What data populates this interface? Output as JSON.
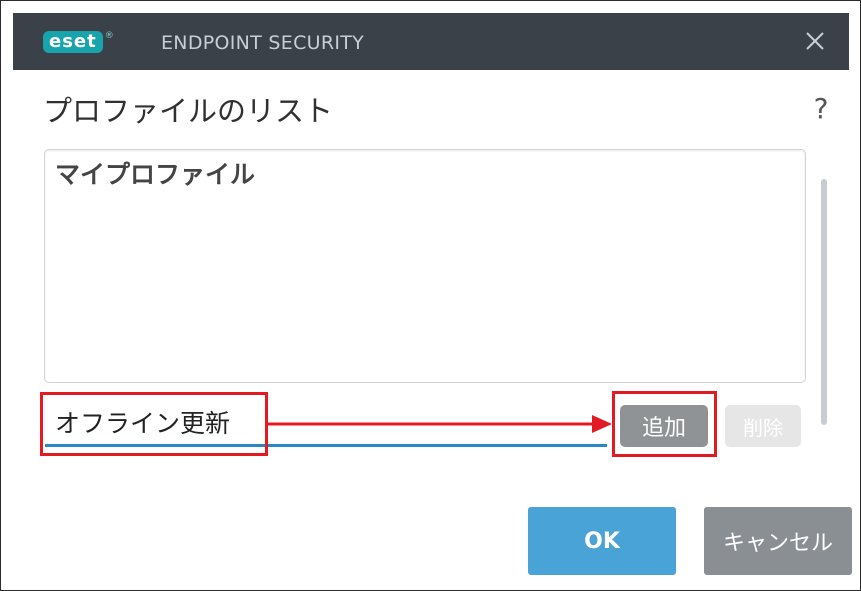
{
  "titlebar": {
    "logo_text": "eset",
    "logo_mark": "®",
    "title": "ENDPOINT SECURITY",
    "close_icon": "close-icon"
  },
  "dialog": {
    "heading": "プロファイルのリスト",
    "help": "?"
  },
  "profiles": {
    "items": [
      "マイプロファイル"
    ]
  },
  "new_profile": {
    "value": "オフライン更新",
    "add_label": "追加",
    "delete_label": "削除"
  },
  "footer": {
    "ok_label": "OK",
    "cancel_label": "キャンセル"
  },
  "colors": {
    "titlebar": "#3a4149",
    "brand": "#19a3ad",
    "accent": "#4aa3d6",
    "highlight": "#e21b22"
  }
}
